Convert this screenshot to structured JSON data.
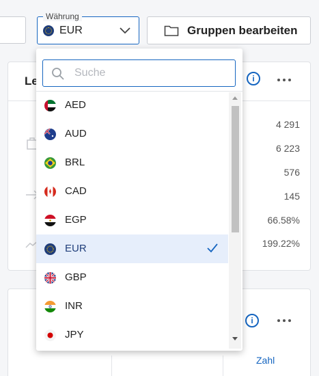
{
  "currency_select": {
    "label": "Währung",
    "value": "EUR"
  },
  "toolbar": {
    "edit_groups_label": "Gruppen bearbeiten"
  },
  "card_top": {
    "title_partial": "Le",
    "values": [
      "4 291",
      "6 223",
      "576",
      "145",
      "66.58%",
      "199.22%"
    ]
  },
  "card_bottom": {
    "link_label": "Zahl"
  },
  "dropdown": {
    "search_placeholder": "Suche",
    "options": [
      {
        "code": "AED",
        "flag": "ae-flag-icon"
      },
      {
        "code": "AUD",
        "flag": "au-flag-icon"
      },
      {
        "code": "BRL",
        "flag": "br-flag-icon"
      },
      {
        "code": "CAD",
        "flag": "ca-flag-icon"
      },
      {
        "code": "EGP",
        "flag": "eg-flag-icon"
      },
      {
        "code": "EUR",
        "flag": "eu-flag-icon",
        "selected": true
      },
      {
        "code": "GBP",
        "flag": "gb-flag-icon"
      },
      {
        "code": "INR",
        "flag": "in-flag-icon"
      },
      {
        "code": "JPY",
        "flag": "jp-flag-icon"
      }
    ]
  },
  "colors": {
    "accent": "#1565c0",
    "selected_bg": "#e6eefb"
  }
}
